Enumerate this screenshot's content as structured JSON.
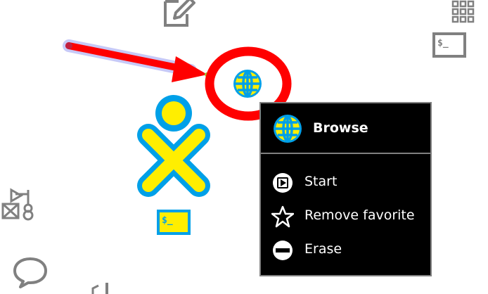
{
  "palette": {
    "title": "Browse",
    "items": [
      {
        "label": "Start",
        "icon": "play-icon"
      },
      {
        "label": "Remove favorite",
        "icon": "star-outline-icon"
      },
      {
        "label": "Erase",
        "icon": "erase-icon"
      }
    ]
  },
  "terminal_glyph": "$_",
  "colors": {
    "annotation_red": "#ff0000",
    "xo_stroke": "#00a0e8",
    "xo_fill": "#ffee00",
    "neutral_icon": "#808080",
    "palette_bg": "#000000"
  }
}
